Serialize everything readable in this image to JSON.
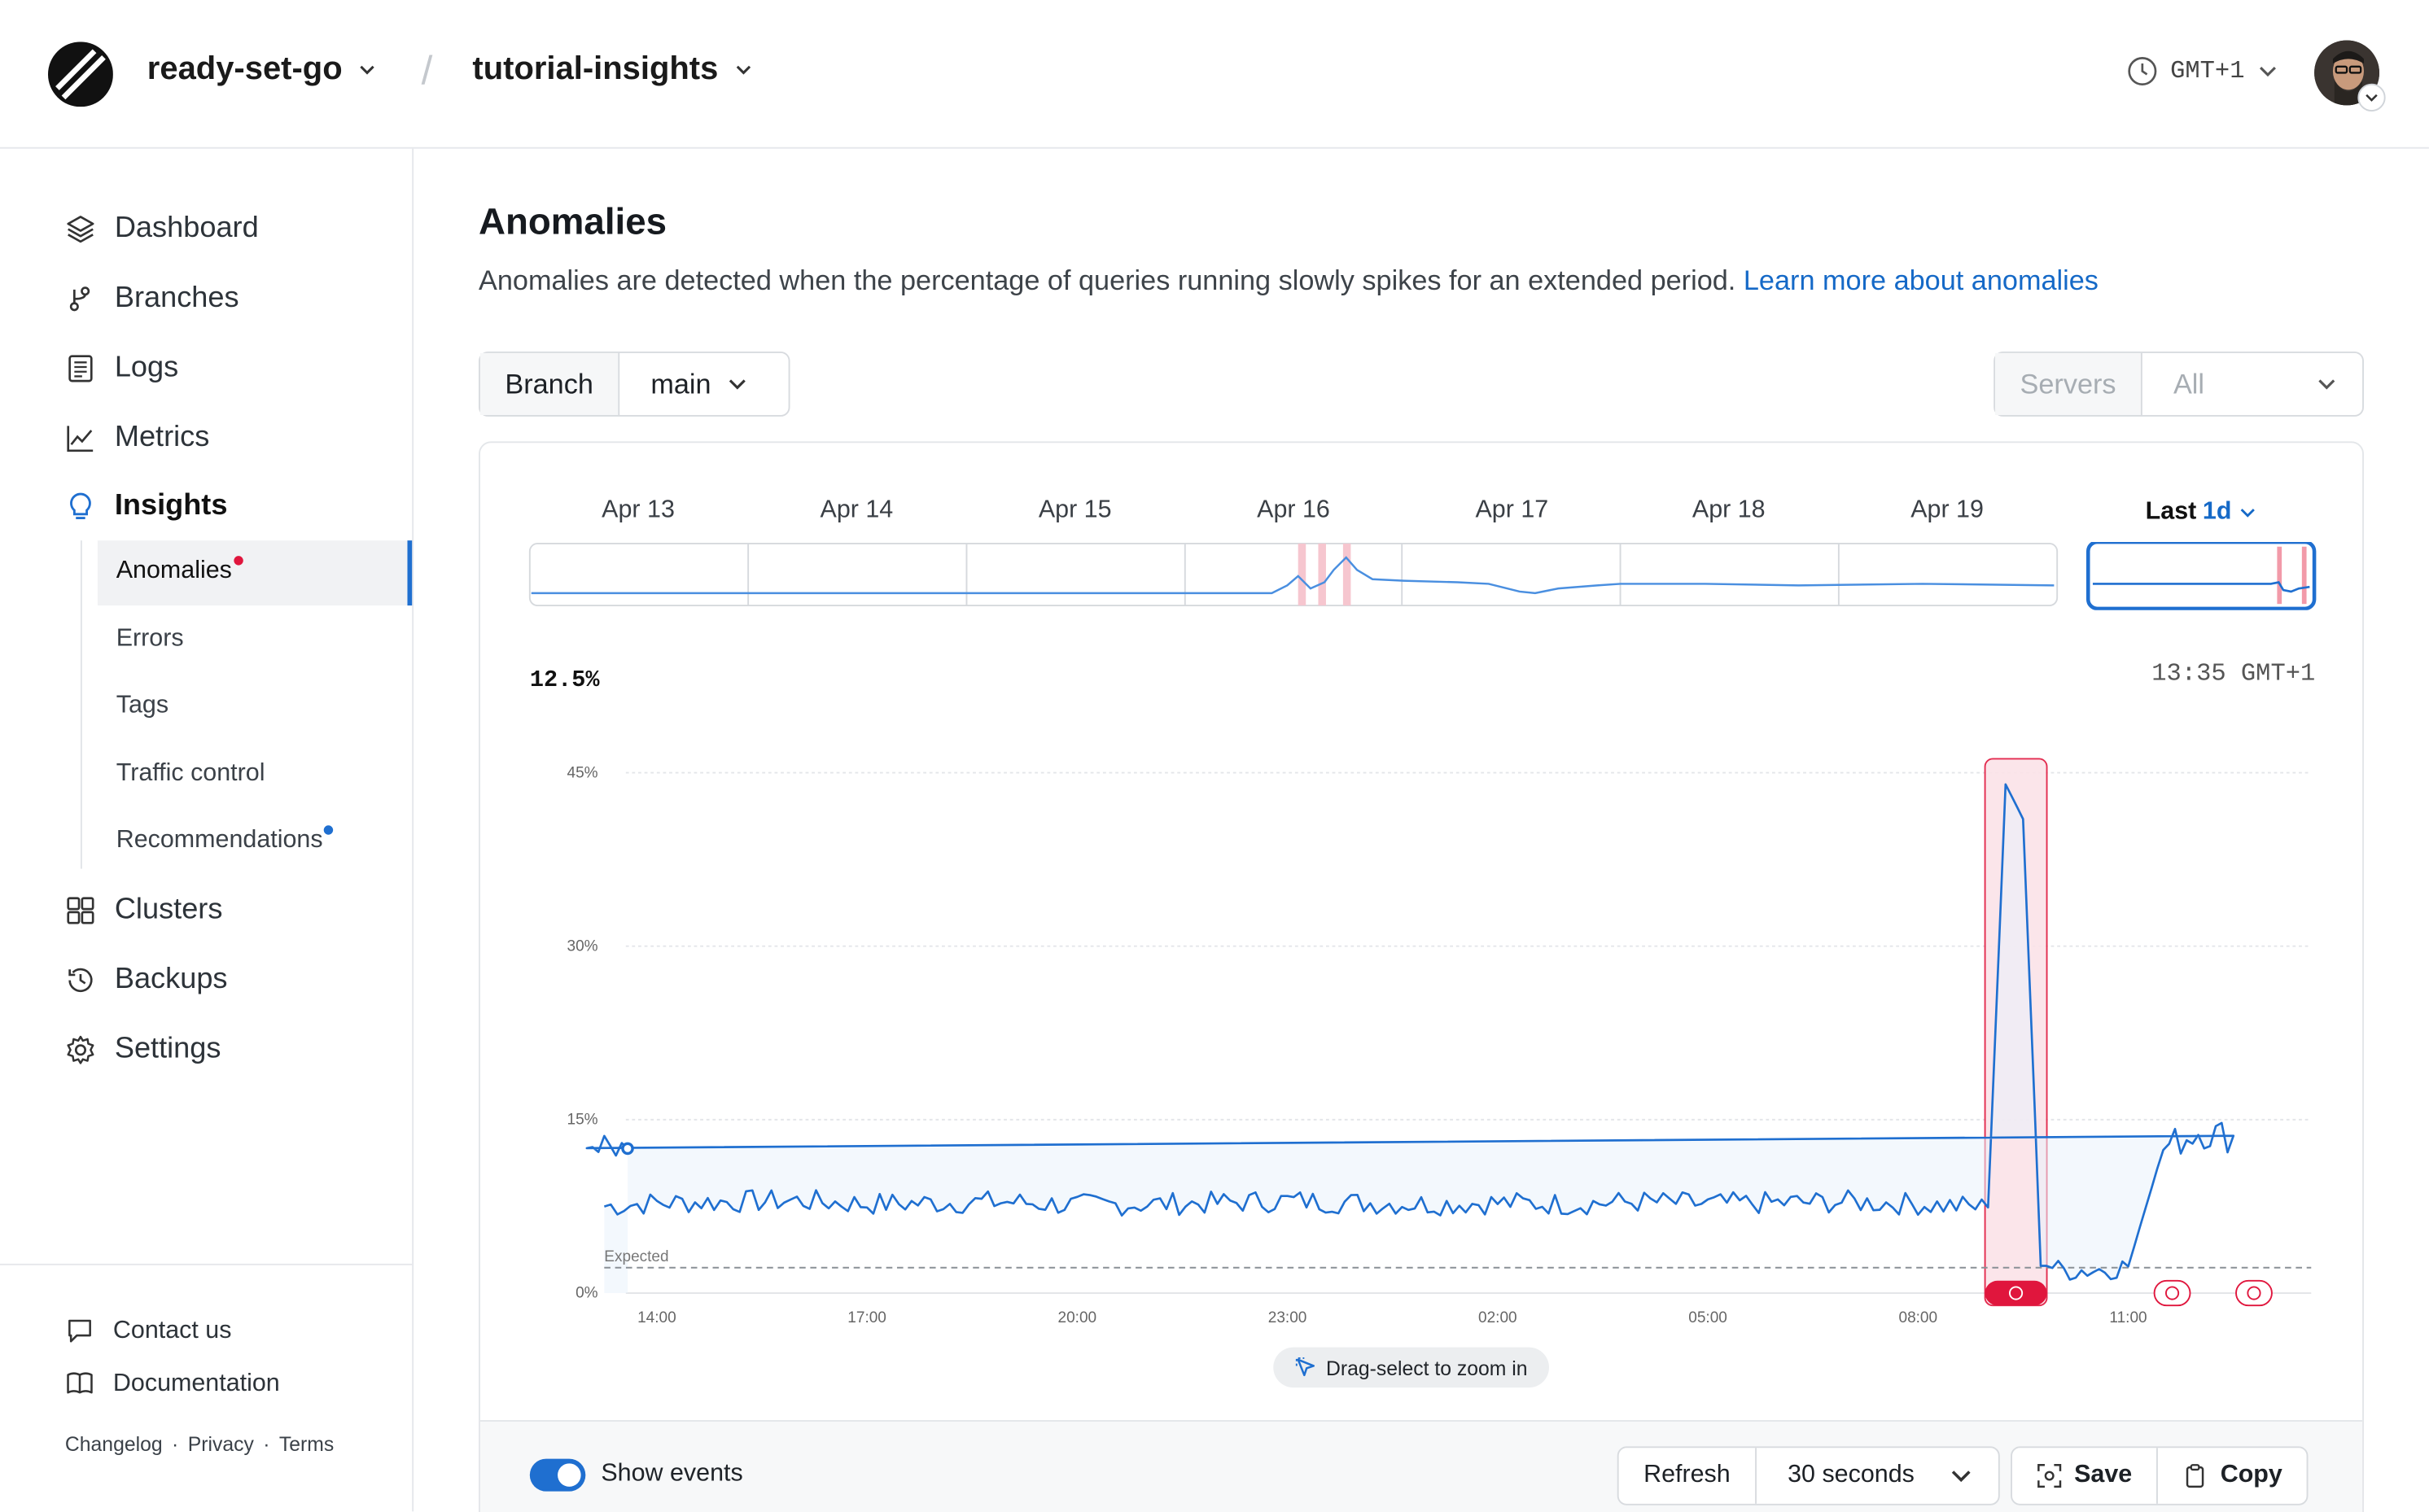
{
  "header": {
    "org": "ready-set-go",
    "database": "tutorial-insights",
    "timezone": "GMT+1"
  },
  "sidebar": {
    "items": [
      {
        "label": "Dashboard",
        "icon": "layers-icon"
      },
      {
        "label": "Branches",
        "icon": "branch-icon"
      },
      {
        "label": "Logs",
        "icon": "logs-icon"
      },
      {
        "label": "Metrics",
        "icon": "chart-icon"
      },
      {
        "label": "Insights",
        "icon": "lightbulb-icon"
      }
    ],
    "subitems": [
      {
        "label": "Anomalies"
      },
      {
        "label": "Errors"
      },
      {
        "label": "Tags"
      },
      {
        "label": "Traffic control"
      },
      {
        "label": "Recommendations"
      }
    ],
    "items2": [
      {
        "label": "Clusters",
        "icon": "clusters-icon"
      },
      {
        "label": "Backups",
        "icon": "backup-icon"
      },
      {
        "label": "Settings",
        "icon": "gear-icon"
      }
    ],
    "footer": {
      "contact": "Contact us",
      "docs": "Documentation",
      "changelog": "Changelog",
      "privacy": "Privacy",
      "terms": "Terms",
      "sep": "·"
    }
  },
  "page": {
    "title": "Anomalies",
    "description": "Anomalies are detected when the percentage of queries running slowly spikes for an extended period.",
    "learn_more": "Learn more about anomalies"
  },
  "filters": {
    "branch_label": "Branch",
    "branch_value": "main",
    "servers_label": "Servers",
    "servers_value": "All"
  },
  "timeline": {
    "days": [
      "Apr 13",
      "Apr 14",
      "Apr 15",
      "Apr 16",
      "Apr 17",
      "Apr 18",
      "Apr 19"
    ],
    "range_prefix": "Last",
    "range_value": "1d"
  },
  "chart": {
    "readout_value": "12.5%",
    "readout_time": "13:35 GMT+1",
    "drag_hint": "Drag-select to zoom in",
    "expected_label": "Expected",
    "accent": "#1f6fd0",
    "anomaly_color": "#e0163d"
  },
  "chart_data": {
    "type": "line",
    "title": "",
    "xlabel": "",
    "ylabel": "",
    "y_ticks": [
      "45%",
      "30%",
      "15%",
      "0%"
    ],
    "x_ticks": [
      "14:00",
      "17:00",
      "20:00",
      "23:00",
      "02:00",
      "05:00",
      "08:00",
      "11:00"
    ],
    "ylim": [
      0,
      45
    ],
    "expected": 2.2,
    "series": [
      {
        "name": "",
        "points": [
          [
            "13:15",
            7.5
          ],
          [
            "14:00",
            7.8
          ],
          [
            "15:00",
            7.9
          ],
          [
            "16:00",
            8.0
          ],
          [
            "17:00",
            7.7
          ],
          [
            "18:00",
            7.8
          ],
          [
            "19:00",
            7.9
          ],
          [
            "20:00",
            7.6
          ],
          [
            "21:00",
            7.7
          ],
          [
            "22:00",
            7.8
          ],
          [
            "23:00",
            8.0
          ],
          [
            "00:00",
            7.8
          ],
          [
            "01:00",
            7.7
          ],
          [
            "02:00",
            7.8
          ],
          [
            "03:00",
            7.7
          ],
          [
            "04:00",
            7.9
          ],
          [
            "05:00",
            7.7
          ],
          [
            "06:00",
            7.8
          ],
          [
            "07:00",
            7.9
          ],
          [
            "08:00",
            7.7
          ],
          [
            "09:00",
            7.4
          ],
          [
            "09:15",
            44.0
          ],
          [
            "09:30",
            41.0
          ],
          [
            "09:45",
            3.0
          ],
          [
            "10:00",
            2.0
          ],
          [
            "10:30",
            2.0
          ],
          [
            "11:00",
            2.3
          ],
          [
            "11:30",
            12.5
          ],
          [
            "12:00",
            14.0
          ],
          [
            "12:30",
            13.5
          ],
          [
            "13:00",
            13.2
          ],
          [
            "13:35",
            12.5
          ]
        ]
      }
    ],
    "anomalies": [
      {
        "start": "09:00",
        "end": "09:45",
        "status": "active"
      },
      {
        "start": "11:25",
        "end": "11:45",
        "status": "resolved"
      },
      {
        "start": "12:35",
        "end": "12:55",
        "status": "resolved"
      }
    ],
    "grid": true
  },
  "footer_controls": {
    "show_events": "Show events",
    "refresh": "Refresh",
    "interval": "30 seconds",
    "save": "Save",
    "copy": "Copy"
  }
}
